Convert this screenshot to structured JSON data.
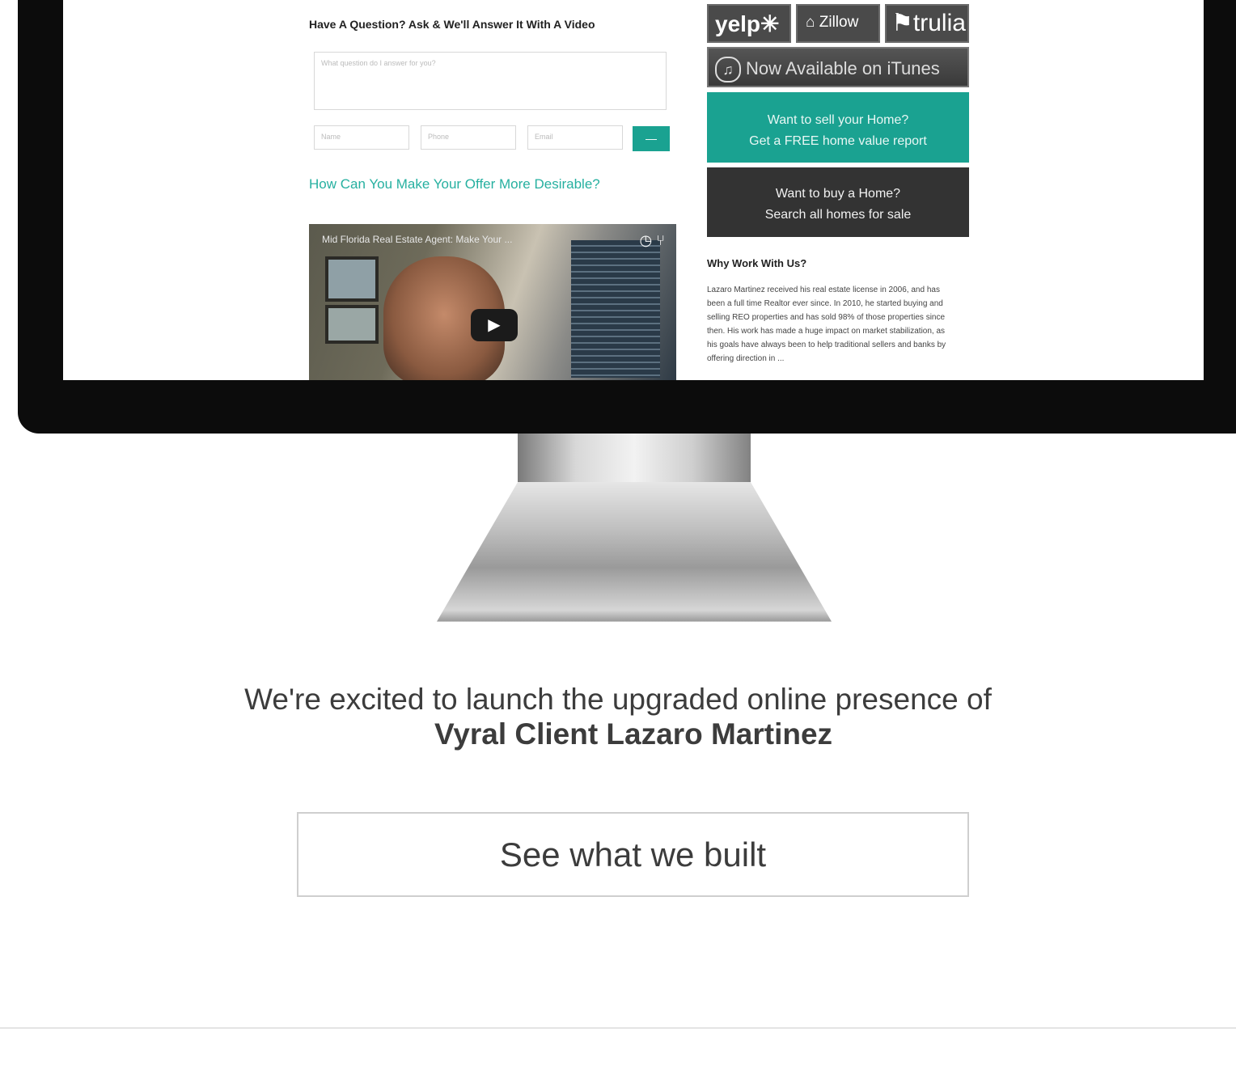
{
  "screen": {
    "question_heading": "Have A Question? Ask & We'll Answer It With A Video",
    "question_placeholder": "What question do I answer for you?",
    "name_placeholder": "Name",
    "phone_placeholder": "Phone",
    "email_placeholder": "Email",
    "submit_label": "—",
    "offer_link": "How Can You Make Your Offer More Desirable?",
    "video": {
      "title": "Mid Florida Real Estate Agent: Make Your ...",
      "play_glyph": "▶",
      "icons_glyph": "◷ ⑂"
    },
    "badges": {
      "yelp": "yelp✳",
      "zillow": "⌂ Zillow",
      "trulia": "⚑trulia"
    },
    "itunes": {
      "note_glyph": "♫",
      "label": "Now Available on iTunes"
    },
    "cta_sell": {
      "line1": "Want to sell your Home?",
      "line2": "Get a FREE home value report"
    },
    "cta_buy": {
      "line1": "Want to buy a Home?",
      "line2": "Search all homes for sale"
    },
    "why_heading": "Why Work With Us?",
    "why_text": "Lazaro Martinez received his real estate license in 2006, and has been a full time Realtor ever since. In 2010, he started buying and selling REO properties and has sold 98% of those properties since then. His work has made a huge impact on market stabilization, as his goals have always been to help traditional sellers and banks by offering direction in ..."
  },
  "announcement": {
    "intro": "We're excited to launch the upgraded online presence of",
    "client": "Vyral Client Lazaro Martinez"
  },
  "button": {
    "label": "See what we built"
  },
  "colors": {
    "accent": "#1aa291",
    "dark_cta": "#333333",
    "bezel": "#0c0c0c"
  }
}
